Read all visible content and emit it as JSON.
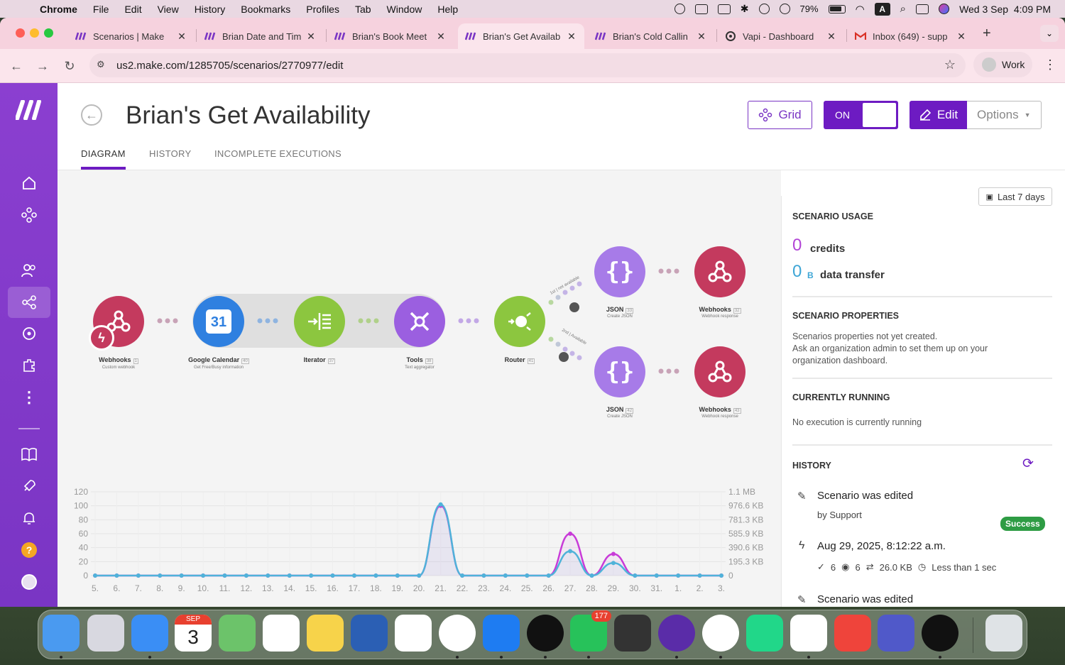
{
  "menubar": {
    "app": "Chrome",
    "items": [
      "File",
      "Edit",
      "View",
      "History",
      "Bookmarks",
      "Profiles",
      "Tab",
      "Window",
      "Help"
    ],
    "battery": "79%",
    "input_source": "A",
    "clock": "Wed 3 Sep  4:09 PM"
  },
  "tabs": [
    {
      "title": "Scenarios | Make",
      "icon": "make-icon"
    },
    {
      "title": "Brian Date and Tim",
      "icon": "make-icon"
    },
    {
      "title": "Brian's Book Meet",
      "icon": "make-icon"
    },
    {
      "title": "Brian's Get Availab",
      "icon": "make-icon",
      "active": true
    },
    {
      "title": "Brian's Cold Callin",
      "icon": "make-icon"
    },
    {
      "title": "Vapi - Dashboard",
      "icon": "vapi-icon"
    },
    {
      "title": "Inbox (649) - supp",
      "icon": "gmail-icon"
    }
  ],
  "address": {
    "url": "us2.make.com/1285705/scenarios/2770977/edit",
    "profile": "Work"
  },
  "scenario": {
    "title": "Brian's Get Availability",
    "grid_label": "Grid",
    "toggle_label": "ON",
    "edit_label": "Edit",
    "options_label": "Options"
  },
  "subtabs": [
    "DIAGRAM",
    "HISTORY",
    "INCOMPLETE EXECUTIONS"
  ],
  "nodes": [
    {
      "name": "Webhooks",
      "num": "1",
      "sub": "Custom webhook",
      "color": "#c43a5e"
    },
    {
      "name": "Google Calendar",
      "num": "40",
      "sub": "Get Free/Busy information",
      "color": "#2f80e0"
    },
    {
      "name": "Iterator",
      "num": "37",
      "sub": "",
      "color": "#8cc63f"
    },
    {
      "name": "Tools",
      "num": "38",
      "sub": "Text aggregator",
      "color": "#9b5fe0"
    },
    {
      "name": "Router",
      "num": "41",
      "sub": "",
      "color": "#8cc63f"
    },
    {
      "name": "JSON",
      "num": "33",
      "sub": "Create JSON",
      "color": "#a77be8"
    },
    {
      "name": "Webhooks",
      "num": "32",
      "sub": "Webhook response",
      "color": "#c43a5e"
    },
    {
      "name": "JSON",
      "num": "42",
      "sub": "Create JSON",
      "color": "#a77be8"
    },
    {
      "name": "Webhooks",
      "num": "43",
      "sub": "Webhook response",
      "color": "#c43a5e"
    }
  ],
  "route_labels": {
    "route1": "1st | not available",
    "route2": "2nd | Available"
  },
  "panel": {
    "usage_title": "SCENARIO USAGE",
    "range_label": "Last 7 days",
    "credits_value": "0",
    "credits_label": "credits",
    "transfer_value": "0",
    "transfer_unit": "B",
    "transfer_label": "data transfer",
    "props_title": "SCENARIO PROPERTIES",
    "props_text": [
      "Scenarios properties not yet created.",
      "Ask an organization admin to set them up on your",
      "organization dashboard."
    ],
    "running_title": "CURRENTLY RUNNING",
    "running_text": "No execution is currently running",
    "history_title": "HISTORY",
    "history": [
      {
        "title": "Scenario was edited",
        "by": "by Support"
      },
      {
        "title": "Aug 29, 2025, 8:12:22 a.m.",
        "status": "Success",
        "ops": "6",
        "views": "6",
        "size": "26.0 KB",
        "duration": "Less than 1 sec"
      },
      {
        "title": "Scenario was edited"
      }
    ]
  },
  "chart_data": {
    "type": "line",
    "x": [
      "5.",
      "6.",
      "7.",
      "8.",
      "9.",
      "10.",
      "11.",
      "12.",
      "13.",
      "14.",
      "15.",
      "16.",
      "17.",
      "18.",
      "19.",
      "20.",
      "21.",
      "22.",
      "23.",
      "24.",
      "25.",
      "26.",
      "27.",
      "28.",
      "29.",
      "30.",
      "31.",
      "1.",
      "2.",
      "3."
    ],
    "yticks_left": [
      "0",
      "20",
      "40",
      "60",
      "80",
      "100",
      "120"
    ],
    "yticks_right": [
      "0",
      "195.3 KB",
      "390.6 KB",
      "585.9 KB",
      "781.3 KB",
      "976.6 KB",
      "1.1 MB"
    ],
    "ylim": [
      0,
      120
    ],
    "series": [
      {
        "values": [
          0,
          0,
          0,
          0,
          0,
          0,
          0,
          0,
          0,
          0,
          0,
          0,
          0,
          0,
          0,
          0,
          100,
          0,
          0,
          0,
          0,
          0,
          60,
          0,
          31,
          0,
          0,
          0,
          0,
          0
        ],
        "color": "#c83bd8"
      },
      {
        "values": [
          0,
          0,
          0,
          0,
          0,
          0,
          0,
          0,
          0,
          0,
          0,
          0,
          0,
          0,
          0,
          0,
          102,
          0,
          0,
          0,
          0,
          0,
          35,
          0,
          18,
          0,
          0,
          0,
          0,
          0
        ],
        "color": "#4fb3d9"
      }
    ]
  },
  "dock": [
    "finder",
    "launchpad",
    "mail",
    "calendar",
    "maps",
    "reminders",
    "notes",
    "word",
    "photos",
    "chrome",
    "app-store",
    "spotify",
    "whatsapp",
    "calculator",
    "firefox",
    "ticktick",
    "pycharm",
    "slack",
    "anydesk",
    "teams",
    "upwork",
    "trash"
  ],
  "dock_badge": "177",
  "dock_calendar": {
    "month": "SEP",
    "day": "3"
  }
}
